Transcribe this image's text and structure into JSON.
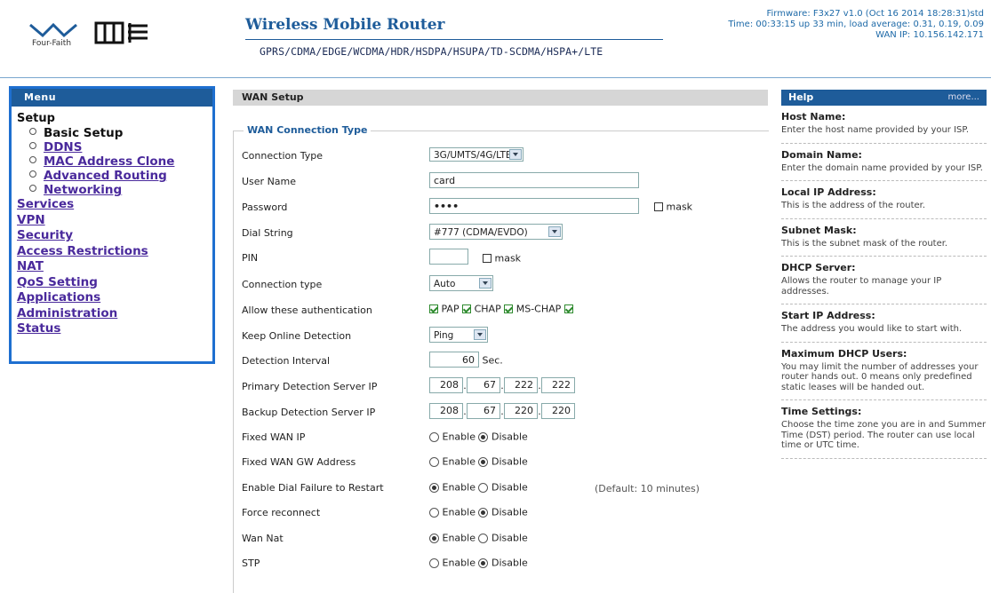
{
  "header": {
    "brand": "Four-Faith",
    "title": "Wireless Mobile Router",
    "subtitle": "GPRS/CDMA/EDGE/WCDMA/HDR/HSDPA/HSUPA/TD-SCDMA/HSPA+/LTE",
    "firmware": "Firmware: F3x27 v1.0 (Oct 16 2014 18:28:31)std",
    "time": "Time: 00:33:15 up 33 min, load average: 0.31, 0.19, 0.09",
    "wan_ip": "WAN IP: 10.156.142.171"
  },
  "menu": {
    "title": "Menu",
    "setup": "Setup",
    "sub_items": [
      {
        "label": "Basic Setup",
        "current": true
      },
      {
        "label": "DDNS"
      },
      {
        "label": "MAC Address Clone"
      },
      {
        "label": "Advanced Routing"
      },
      {
        "label": "Networking"
      }
    ],
    "items": [
      "Services",
      "VPN",
      "Security",
      "Access Restrictions",
      "NAT",
      "QoS Setting",
      "Applications",
      "Administration",
      "Status"
    ]
  },
  "wan": {
    "panel_title": "WAN Setup",
    "legend": "WAN Connection Type",
    "connection_type_label": "Connection Type",
    "connection_type_value": "3G/UMTS/4G/LTE",
    "user_name_label": "User Name",
    "user_name_value": "card",
    "password_label": "Password",
    "password_value": "••••",
    "mask_label": "mask",
    "dial_string_label": "Dial String",
    "dial_string_value": "#777 (CDMA/EVDO)",
    "pin_label": "PIN",
    "conn_type2_label": "Connection type",
    "conn_type2_value": "Auto",
    "auth_label": "Allow these authentication",
    "auth_options": [
      "PAP",
      "CHAP",
      "MS-CHAP"
    ],
    "keep_online_label": "Keep Online Detection",
    "keep_online_value": "Ping",
    "detection_interval_label": "Detection Interval",
    "detection_interval_value": "60",
    "sec_unit": "Sec.",
    "primary_ip_label": "Primary Detection Server IP",
    "primary_ip": [
      "208",
      "67",
      "222",
      "222"
    ],
    "backup_ip_label": "Backup Detection Server IP",
    "backup_ip": [
      "208",
      "67",
      "220",
      "220"
    ],
    "enable_label": "Enable",
    "disable_label": "Disable",
    "default_note": "(Default: 10 minutes)",
    "toggles": [
      {
        "label": "Fixed WAN IP",
        "enabled": false
      },
      {
        "label": "Fixed WAN GW Address",
        "enabled": false
      },
      {
        "label": "Enable Dial Failure to Restart",
        "enabled": true
      },
      {
        "label": "Force reconnect",
        "enabled": false
      },
      {
        "label": "Wan Nat",
        "enabled": true
      },
      {
        "label": "STP",
        "enabled": false
      }
    ]
  },
  "help": {
    "title": "Help",
    "more": "more...",
    "sections": [
      {
        "title": "Host Name:",
        "text": "Enter the host name provided by your ISP."
      },
      {
        "title": "Domain Name:",
        "text": "Enter the domain name provided by your ISP."
      },
      {
        "title": "Local IP Address:",
        "text": "This is the address of the router."
      },
      {
        "title": "Subnet Mask:",
        "text": "This is the subnet mask of the router."
      },
      {
        "title": "DHCP Server:",
        "text": "Allows the router to manage your IP addresses."
      },
      {
        "title": "Start IP Address:",
        "text": "The address you would like to start with."
      },
      {
        "title": "Maximum DHCP Users:",
        "text": "You may limit the number of addresses your router hands out. 0 means only predefined static leases will be handed out."
      },
      {
        "title": "Time Settings:",
        "text": "Choose the time zone you are in and Summer Time (DST) period. The router can use local time or UTC time."
      }
    ]
  },
  "colors": {
    "accent": "#1e5c9a",
    "menu_border": "#1e6fd0",
    "link": "#4a2a9c"
  }
}
